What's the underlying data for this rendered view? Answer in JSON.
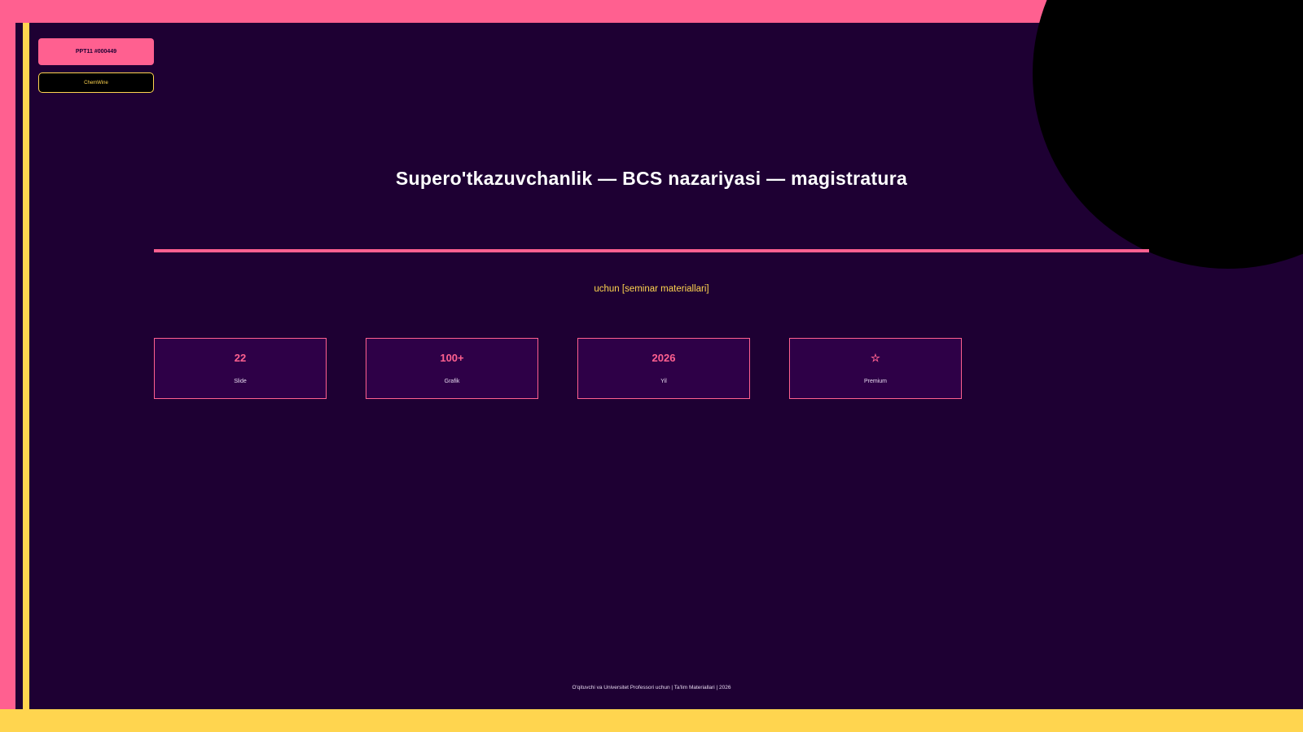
{
  "badge": {
    "label": "PPT11 #000449"
  },
  "brand": {
    "label": "ChemWine"
  },
  "slide": {
    "title": "Supero'tkazuvchanlik — BCS nazariyasi — magistratura",
    "subtitle": "uchun [seminar materiallari]"
  },
  "stats": [
    {
      "value": "22",
      "label": "Slide"
    },
    {
      "value": "100+",
      "label": "Grafik"
    },
    {
      "value": "2026",
      "label": "Yil"
    },
    {
      "value": "☆",
      "label": "Premium"
    }
  ],
  "footer": {
    "text": "O'qituvchi va Universitet Professori uchun | Ta'lim Materiallari | 2026"
  },
  "colors": {
    "background": "#1e0033",
    "accent_pink": "#ff6090",
    "accent_yellow": "#ffd54f",
    "card_fill": "#2e0047",
    "circle": "#000000"
  }
}
